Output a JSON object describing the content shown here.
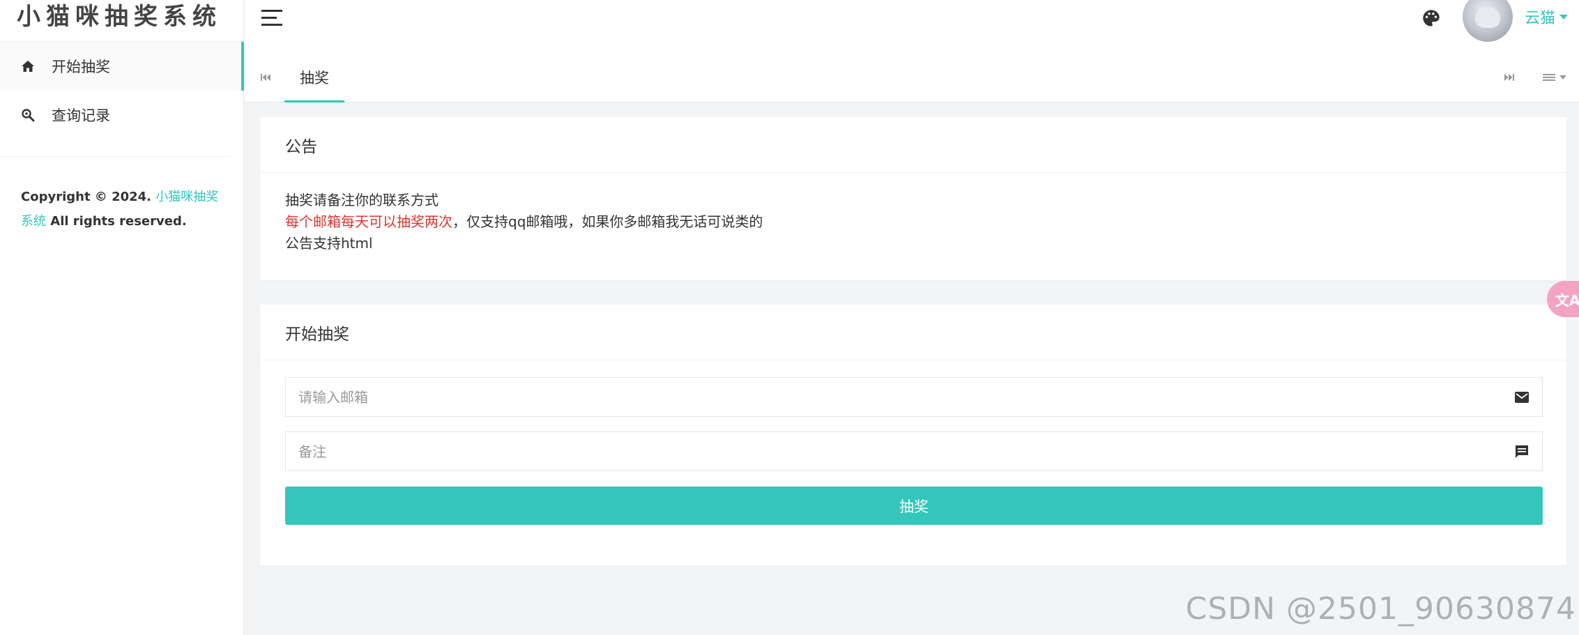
{
  "app": {
    "title": "小猫咪抽奖系统"
  },
  "sidebar": {
    "items": [
      {
        "label": "开始抽奖",
        "icon": "home-icon"
      },
      {
        "label": "查询记录",
        "icon": "search-icon"
      }
    ],
    "copyright": {
      "prefix": "Copyright © 2024.",
      "link": "小猫咪抽奖系统",
      "suffix": " All rights reserved."
    }
  },
  "header": {
    "user": "云猫",
    "palette_icon": "palette-icon"
  },
  "tabs": [
    {
      "label": "抽奖"
    }
  ],
  "notice": {
    "title": "公告",
    "line1": "抽奖请备注你的联系方式",
    "line2_red": "每个邮箱每天可以抽奖两次",
    "line2_rest": "，仅支持qq邮箱哦，如果你多邮箱我无话可说类的",
    "line3": "公告支持html"
  },
  "draw": {
    "title": "开始抽奖",
    "email_placeholder": "请输入邮箱",
    "remark_placeholder": "备注",
    "button": "抽奖"
  },
  "translate_label": "文A",
  "watermark": "CSDN @2501_90630874",
  "colors": {
    "accent": "#34c6bc",
    "red": "#d9362f"
  }
}
